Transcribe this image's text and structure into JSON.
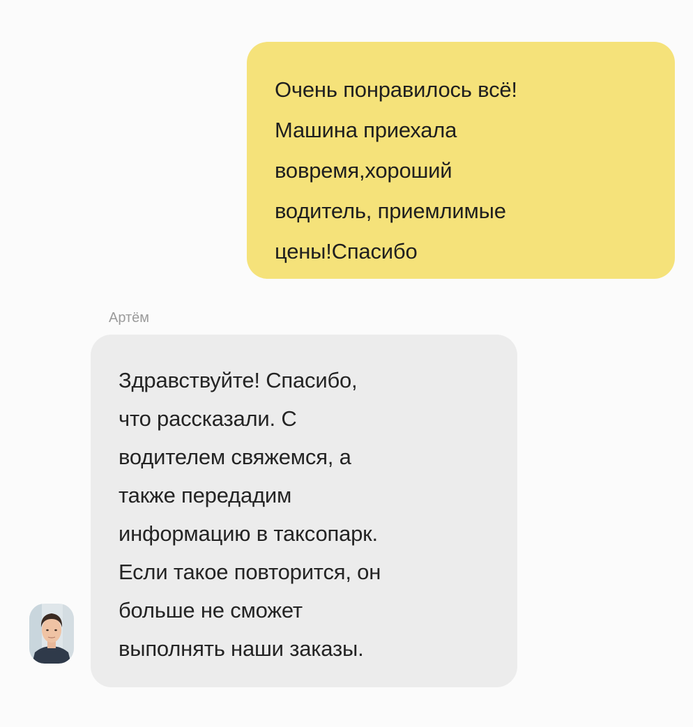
{
  "chat": {
    "outgoing_message": {
      "text": "Очень понравилось всё!\nМашина приехала\nвовремя,хороший\nводитель, приемлимые\nцены!Спасибо"
    },
    "incoming_message": {
      "sender": "Артём",
      "text": "Здравствуйте! Спасибо,\nчто рассказали. С\nводителем свяжемся, а\nтакже передадим\nинформацию в таксопарк.\nЕсли такое повторится, он\nбольше не сможет\nвыполнять наши заказы.",
      "avatar_icon": "user-avatar-photo"
    }
  },
  "colors": {
    "background": "#fbfbfb",
    "outgoing_bubble": "#f5e27a",
    "incoming_bubble": "#ececec",
    "sender_name": "#9a9a9a",
    "text": "#1f1f1f"
  }
}
